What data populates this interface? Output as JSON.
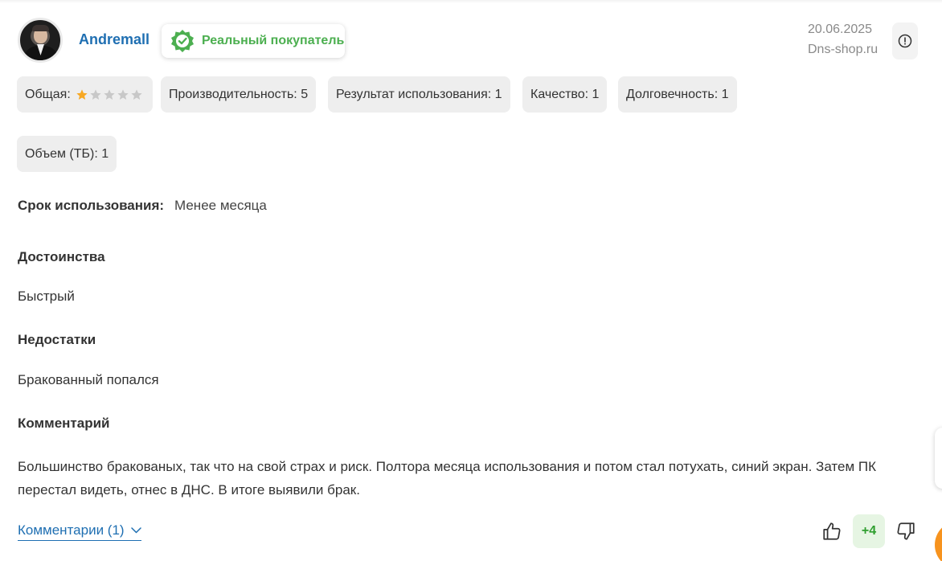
{
  "review": {
    "user": {
      "name": "Andremall"
    },
    "badge": {
      "label": "Реальный покупатель",
      "color": "#4caf50",
      "icon": "verified-seal-icon"
    },
    "date": "20.06.2025",
    "source": "Dns-shop.ru",
    "ratings": {
      "overall_label": "Общая:",
      "overall_stars": 1,
      "overall_max": 5,
      "chips": [
        {
          "label": "Производительность: 5"
        },
        {
          "label": "Результат использования: 1"
        },
        {
          "label": "Качество: 1"
        },
        {
          "label": "Долговечность: 1"
        },
        {
          "label": "Объем (ТБ): 1"
        }
      ]
    },
    "usage": {
      "label": "Срок использования:",
      "value": "Менее месяца"
    },
    "pros": {
      "title": "Достоинства",
      "text": "Быстрый"
    },
    "cons": {
      "title": "Недостатки",
      "text": "Бракованный попался"
    },
    "comment": {
      "title": "Комментарий",
      "text": "Большинство бракованых, так что на свой страх и риск. Полтора месяца использования и потом стал потухать, синий экран. Затем ПК перестал видеть, отнес в ДНС. В итоге выявили брак."
    },
    "comments_link": "Комментарии (1)",
    "votes": {
      "count": "+4",
      "up_icon": "thumbs-up-icon",
      "down_icon": "thumbs-down-icon"
    },
    "colors": {
      "accent": "#1f6fb2",
      "star_filled": "#f7a823",
      "star_empty": "#c8c8c8",
      "positive": "#2e9e2e"
    }
  }
}
